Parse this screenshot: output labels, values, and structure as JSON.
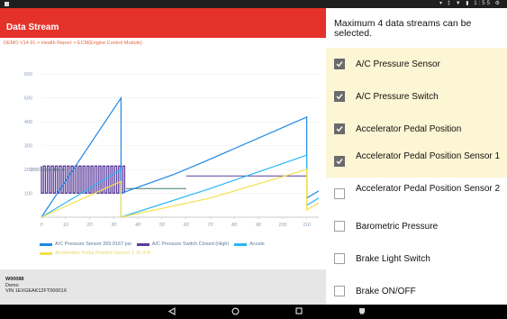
{
  "status_bar": {
    "right_text": "▾ ‡ ▼ ▮  1:55 ⚙"
  },
  "header": {
    "title": "Data Stream"
  },
  "breadcrumb": "DEMO V14.91 > Health Report > ECM(Engine Control Module)",
  "chart_data": {
    "type": "line",
    "y_ticks": [
      "600",
      "500",
      "400",
      "300",
      "200",
      "100"
    ],
    "x_ticks": [
      "0",
      "10",
      "20",
      "30",
      "40",
      "50",
      "60",
      "70",
      "80",
      "90",
      "100",
      "110"
    ],
    "ylim": [
      0,
      650
    ],
    "xlim": [
      0,
      115
    ],
    "annotation": "200Closed(High)",
    "series": [
      {
        "name": "A/C Pressure Sensor 369.9167 psi",
        "color": "#1e88e5",
        "x": [
          0,
          33,
          33,
          55,
          67,
          110,
          110,
          115
        ],
        "y": [
          0,
          500,
          100,
          180,
          230,
          420,
          80,
          110
        ]
      },
      {
        "name": "A/C Pressure Switch Closed (High)",
        "color": "#5b3a9c",
        "x": [
          0,
          35
        ],
        "y": [
          150,
          150
        ]
      },
      {
        "name": "Accelerator Pedal Position",
        "color": "#29b6f6",
        "x": [
          0,
          33,
          33,
          70,
          110,
          110,
          115
        ],
        "y": [
          0,
          200,
          0,
          120,
          260,
          50,
          80
        ]
      },
      {
        "name": "Accelerator Pedal Position Sensor 1",
        "color": "#f4e04d",
        "x": [
          0,
          33,
          33,
          70,
          110,
          110,
          115
        ],
        "y": [
          0,
          150,
          0,
          80,
          200,
          30,
          60
        ]
      }
    ],
    "legend_placement": "bottom"
  },
  "legend": {
    "entries": [
      {
        "label": "A/C Pressure Sensor 369.9167 psi",
        "color": "#1e88e5"
      },
      {
        "label": "A/C Pressure Switch Closed (High)",
        "color": "#5b3a9c"
      },
      {
        "label": "Accele",
        "color": "#29b6f6"
      }
    ],
    "second_line": "Accelerator Pedal Position Sensor 1  16.4 %",
    "second_line_color": "#f4e04d"
  },
  "device": {
    "id": "W00088",
    "name": "Demo",
    "vin": "VIN 1EXGEAK12FT00001X"
  },
  "panel": {
    "notice": "Maximum 4 data streams can be selected.",
    "items": [
      {
        "label": "A/C Pressure Sensor",
        "checked": true
      },
      {
        "label": "A/C Pressure Switch",
        "checked": true
      },
      {
        "label": "Accelerator Pedal Position",
        "checked": true
      },
      {
        "label": "Accelerator Pedal Position Sensor 1",
        "checked": true
      },
      {
        "label": "Accelerator Pedal Position Sensor 2",
        "checked": false
      },
      {
        "label": "Barometric Pressure",
        "checked": false
      },
      {
        "label": "Brake Light Switch",
        "checked": false
      },
      {
        "label": "Brake ON/OFF",
        "checked": false
      }
    ]
  },
  "nav": {
    "back_icon": "back-triangle-icon",
    "home_icon": "home-circle-icon",
    "recents_icon": "recents-square-icon",
    "screenshot_icon": "screenshot-icon"
  }
}
